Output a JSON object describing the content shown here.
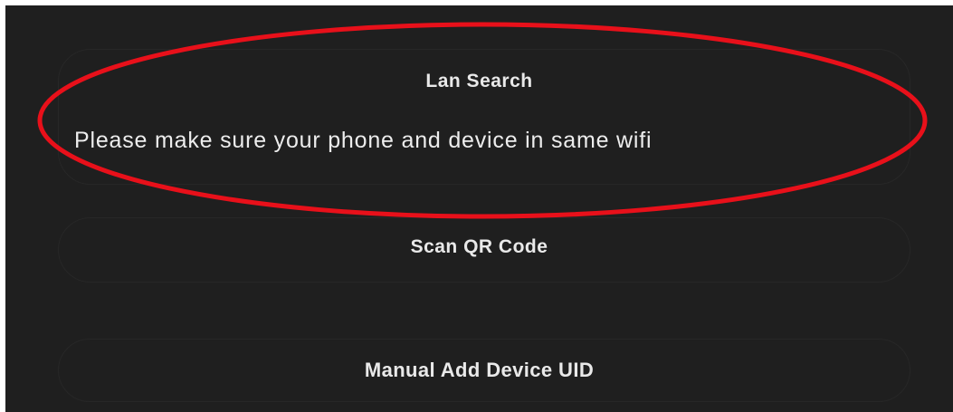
{
  "options": {
    "lan_search": {
      "title": "Lan Search",
      "hint": "Please make sure your phone and device in same wifi"
    },
    "scan_qr": {
      "title": "Scan QR Code"
    },
    "manual_uid": {
      "title": "Manual Add Device UID"
    }
  },
  "annotation": {
    "highlight_color": "#e8101a",
    "shape": "oval",
    "highlights": "lan_search"
  },
  "colors": {
    "background": "#1f1f1f",
    "text": "#e9e9e9",
    "card_border": "#272727",
    "outer_frame": "#ffffff"
  }
}
